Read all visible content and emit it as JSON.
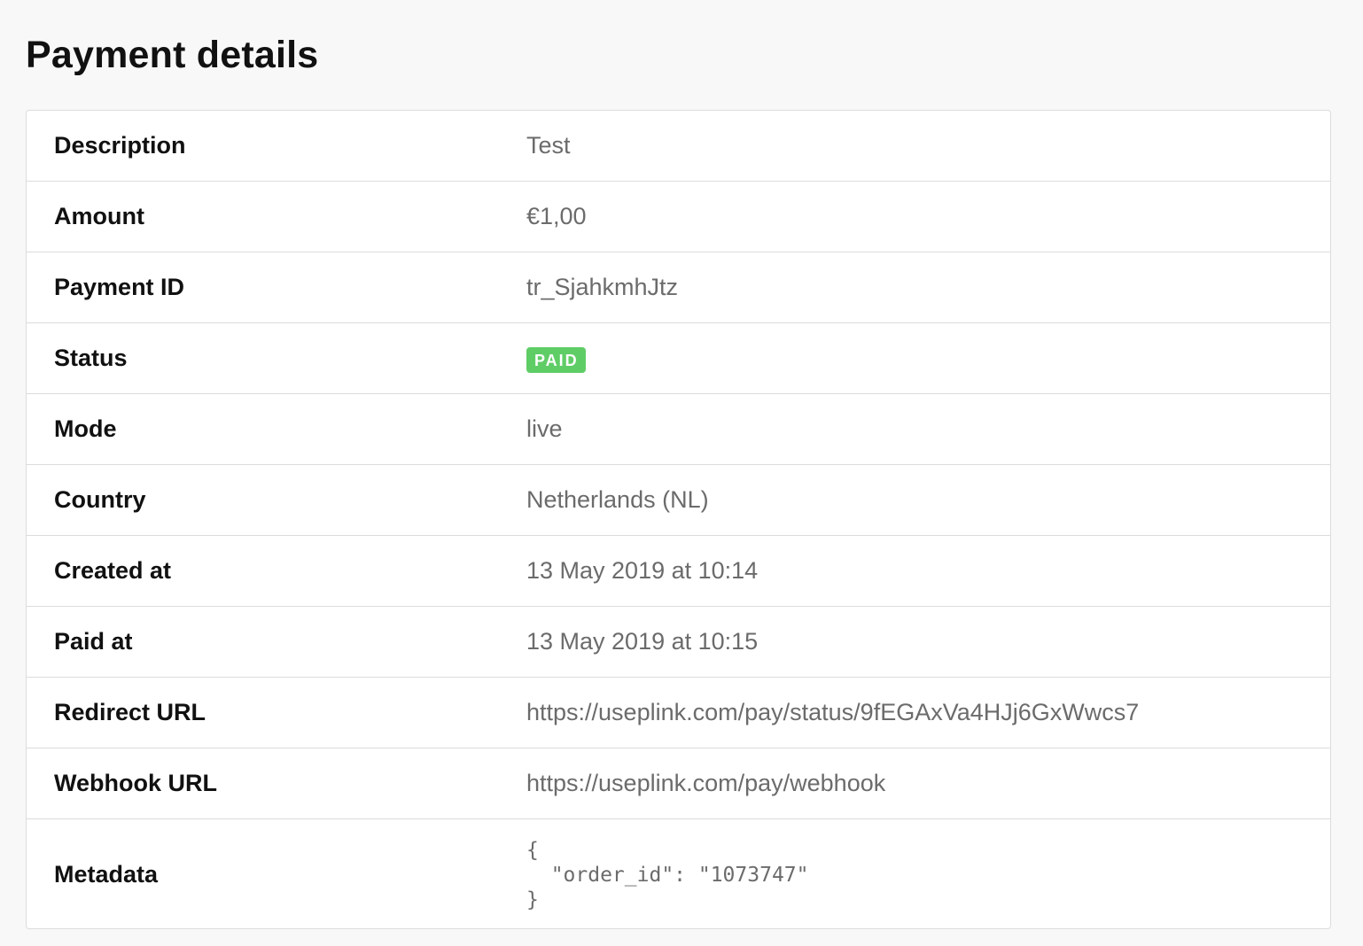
{
  "page": {
    "title": "Payment details"
  },
  "details": {
    "description": {
      "label": "Description",
      "value": "Test"
    },
    "amount": {
      "label": "Amount",
      "value": "€1,00"
    },
    "payment_id": {
      "label": "Payment ID",
      "value": "tr_SjahkmhJtz"
    },
    "status": {
      "label": "Status",
      "value": "PAID"
    },
    "mode": {
      "label": "Mode",
      "value": "live"
    },
    "country": {
      "label": "Country",
      "value": "Netherlands (NL)"
    },
    "created_at": {
      "label": "Created at",
      "value": "13 May 2019 at 10:14"
    },
    "paid_at": {
      "label": "Paid at",
      "value": "13 May 2019 at 10:15"
    },
    "redirect_url": {
      "label": "Redirect URL",
      "value": "https://useplink.com/pay/status/9fEGAxVa4HJj6GxWwcs7"
    },
    "webhook_url": {
      "label": "Webhook URL",
      "value": "https://useplink.com/pay/webhook"
    },
    "metadata": {
      "label": "Metadata",
      "value": "{\n  \"order_id\": \"1073747\"\n}"
    }
  },
  "colors": {
    "status_paid": "#5fcd66",
    "label_text": "#111111",
    "value_text": "#6b6b6b",
    "border": "#dcdcdc",
    "page_background": "#f8f8f8"
  }
}
